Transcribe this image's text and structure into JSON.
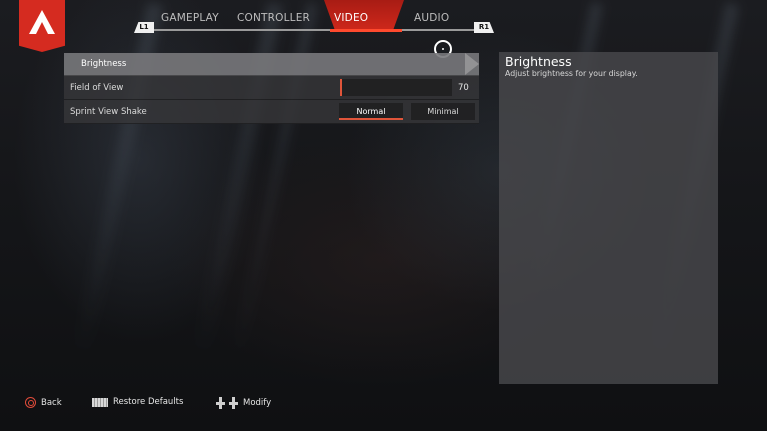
{
  "tabs": {
    "left_bumper": "L1",
    "right_bumper": "R1",
    "items": [
      {
        "label": "GAMEPLAY"
      },
      {
        "label": "CONTROLLER"
      },
      {
        "label": "VIDEO"
      },
      {
        "label": "AUDIO"
      }
    ],
    "active": "VIDEO"
  },
  "settings": {
    "rows": [
      {
        "label": "Brightness"
      },
      {
        "label": "Field of View",
        "value": "70",
        "slider_fraction": 0.02
      },
      {
        "label": "Sprint View Shake",
        "options": [
          "Normal",
          "Minimal"
        ],
        "selected": "Normal"
      }
    ]
  },
  "description": {
    "title": "Brightness",
    "text": "Adjust brightness for your display."
  },
  "footer": {
    "back": "Back",
    "restore": "Restore Defaults",
    "modify_sep": "/",
    "modify": "Modify"
  },
  "colors": {
    "accent": "#d52b20",
    "slider_fill": "#e0553a"
  },
  "icons": [
    "apex-logo-icon",
    "circle-button-icon",
    "touchpad-icon",
    "dpad-icon",
    "cursor-icon"
  ]
}
